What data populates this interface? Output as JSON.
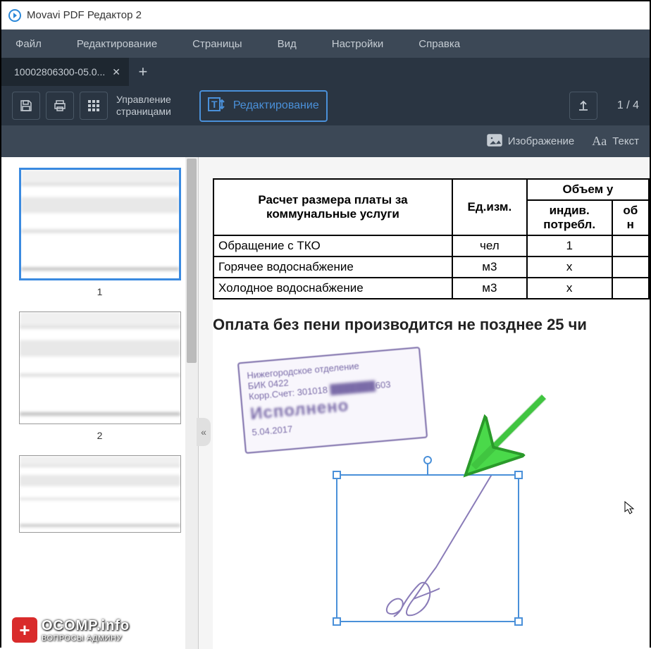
{
  "app": {
    "title": "Movavi PDF Редактор 2"
  },
  "menu": {
    "file": "Файл",
    "edit": "Редактирование",
    "pages": "Страницы",
    "view": "Вид",
    "settings": "Настройки",
    "help": "Справка"
  },
  "tab": {
    "name": "10002806300-05.0...",
    "close": "✕",
    "new": "+"
  },
  "toolbar": {
    "pages_mgmt": "Управление\nстраницами",
    "editing": "Редактирование",
    "page_indicator": "1 / 4"
  },
  "subtoolbar": {
    "image": "Изображение",
    "text": "Текст"
  },
  "thumbnails": [
    {
      "num": "1",
      "selected": true
    },
    {
      "num": "2",
      "selected": false
    },
    {
      "num": "",
      "selected": false
    }
  ],
  "panel_toggle": "«",
  "document": {
    "table": {
      "header_calc": "Расчет размера платы за коммунальные услуги",
      "header_unit": "Ед.изм.",
      "header_volume": "Объем у",
      "sub_indiv": "индив. потребл.",
      "sub_ob": "об",
      "sub_n": "н",
      "rows": [
        {
          "label": "Обращение с ТКО",
          "unit": "чел",
          "indiv": "1",
          "ob": ""
        },
        {
          "label": "Горячее водоснабжение",
          "unit": "м3",
          "indiv": "x",
          "ob": ""
        },
        {
          "label": "Холодное водоснабжение",
          "unit": "м3",
          "indiv": "x",
          "ob": ""
        }
      ]
    },
    "payment_text": "Оплата без пени производится не позднее 25 чи",
    "stamp": {
      "line1": "Нижегородское отделение",
      "bik": "БИК 0422",
      "korr": "Корр.Счет: 301018",
      "korr_end": "603",
      "executed": "Исполнено",
      "date": "5.04.2017"
    }
  },
  "watermark": {
    "main": "OCOMP.info",
    "sub": "ВОПРОСЫ АДМИНУ"
  }
}
